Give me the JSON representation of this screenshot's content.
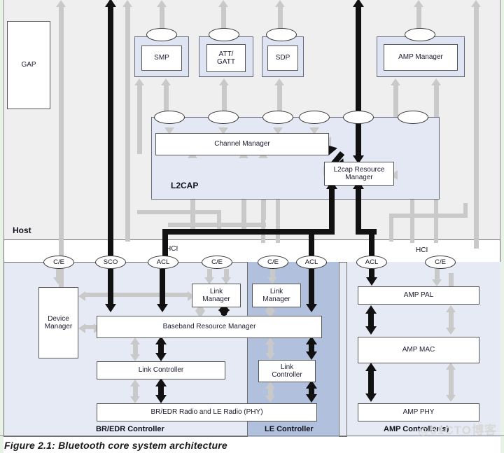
{
  "figure": {
    "caption": "Figure 2.1: Bluetooth core system architecture",
    "watermark": "@51CTO博客"
  },
  "layers": {
    "host_label": "Host",
    "hci_label_left": "HCI",
    "hci_label_right": "HCI"
  },
  "host": {
    "gap": "GAP",
    "protocols": [
      {
        "name": "SMP"
      },
      {
        "name": "ATT/\nGATT"
      },
      {
        "name": "SDP"
      },
      {
        "name": "AMP Manager"
      }
    ],
    "l2cap": {
      "title": "L2CAP",
      "channel_manager": "Channel Manager",
      "resource_manager": "L2cap Resource\nManager"
    }
  },
  "service_access_points": [
    {
      "label": "C/E"
    },
    {
      "label": "SCO"
    },
    {
      "label": "ACL"
    },
    {
      "label": "C/E"
    },
    {
      "label": "C/E"
    },
    {
      "label": "ACL"
    },
    {
      "label": "ACL"
    },
    {
      "label": "C/E"
    }
  ],
  "controllers": {
    "bredr": {
      "title": "BR/EDR Controller",
      "device_manager": "Device\nManager",
      "link_manager": "Link\nManager",
      "baseband_resource_manager": "Baseband Resource Manager",
      "link_controller": "Link Controller",
      "radio": "BR/EDR Radio and LE Radio (PHY)"
    },
    "le": {
      "title": "LE Controller",
      "link_manager": "Link\nManager",
      "link_controller": "Link\nController"
    },
    "amp": {
      "title": "AMP Controller(s)",
      "pal": "AMP PAL",
      "mac": "AMP MAC",
      "phy": "AMP PHY"
    }
  },
  "colors": {
    "host_bg": "#efefef",
    "controller_bg": "#e6eaf5",
    "le_bg": "#b0c0dd",
    "protocol_shell": "#dfe4f2",
    "l2cap_shell": "#e4e8f5",
    "grey_arrow": "#c9c9c9",
    "black_arrow": "#111111"
  }
}
